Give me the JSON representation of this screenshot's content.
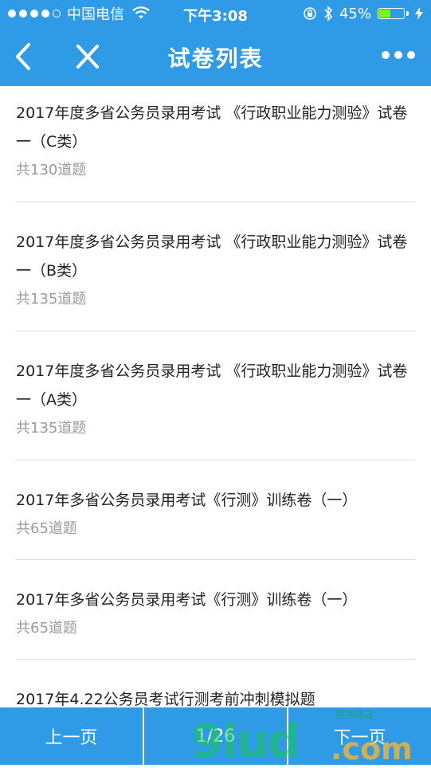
{
  "status_bar": {
    "carrier": "中国电信",
    "time": "下午3:08",
    "battery_percent": "45%",
    "battery_level": 0.45
  },
  "nav": {
    "title": "试卷列表"
  },
  "papers": [
    {
      "title": "2017年度多省公务员录用考试 《行政职业能力测验》试卷一（C类）",
      "count": "共130道题"
    },
    {
      "title": "2017年度多省公务员录用考试 《行政职业能力测验》试卷一（B类）",
      "count": "共135道题"
    },
    {
      "title": "2017年度多省公务员录用考试 《行政职业能力测验》试卷一（A类）",
      "count": "共135道题"
    },
    {
      "title": "2017年多省公务员录用考试《行测》训练卷（一）",
      "count": "共65道题"
    },
    {
      "title": "2017年多省公务员录用考试《行测》训练卷（一）",
      "count": "共65道题"
    },
    {
      "title": "2017年4.22公务员考试行测考前冲刺模拟题",
      "count": ""
    }
  ],
  "pager": {
    "prev_label": "上一页",
    "page_indicator": "1/26",
    "next_label": "下一页"
  },
  "watermark": {
    "main": "9lud",
    "tld": ".com",
    "sub": "程序商店"
  },
  "colors": {
    "primary": "#2f9be6",
    "battery_fill": "#7CFC00",
    "text_primary": "#222222",
    "text_secondary": "#9a9a9a"
  }
}
